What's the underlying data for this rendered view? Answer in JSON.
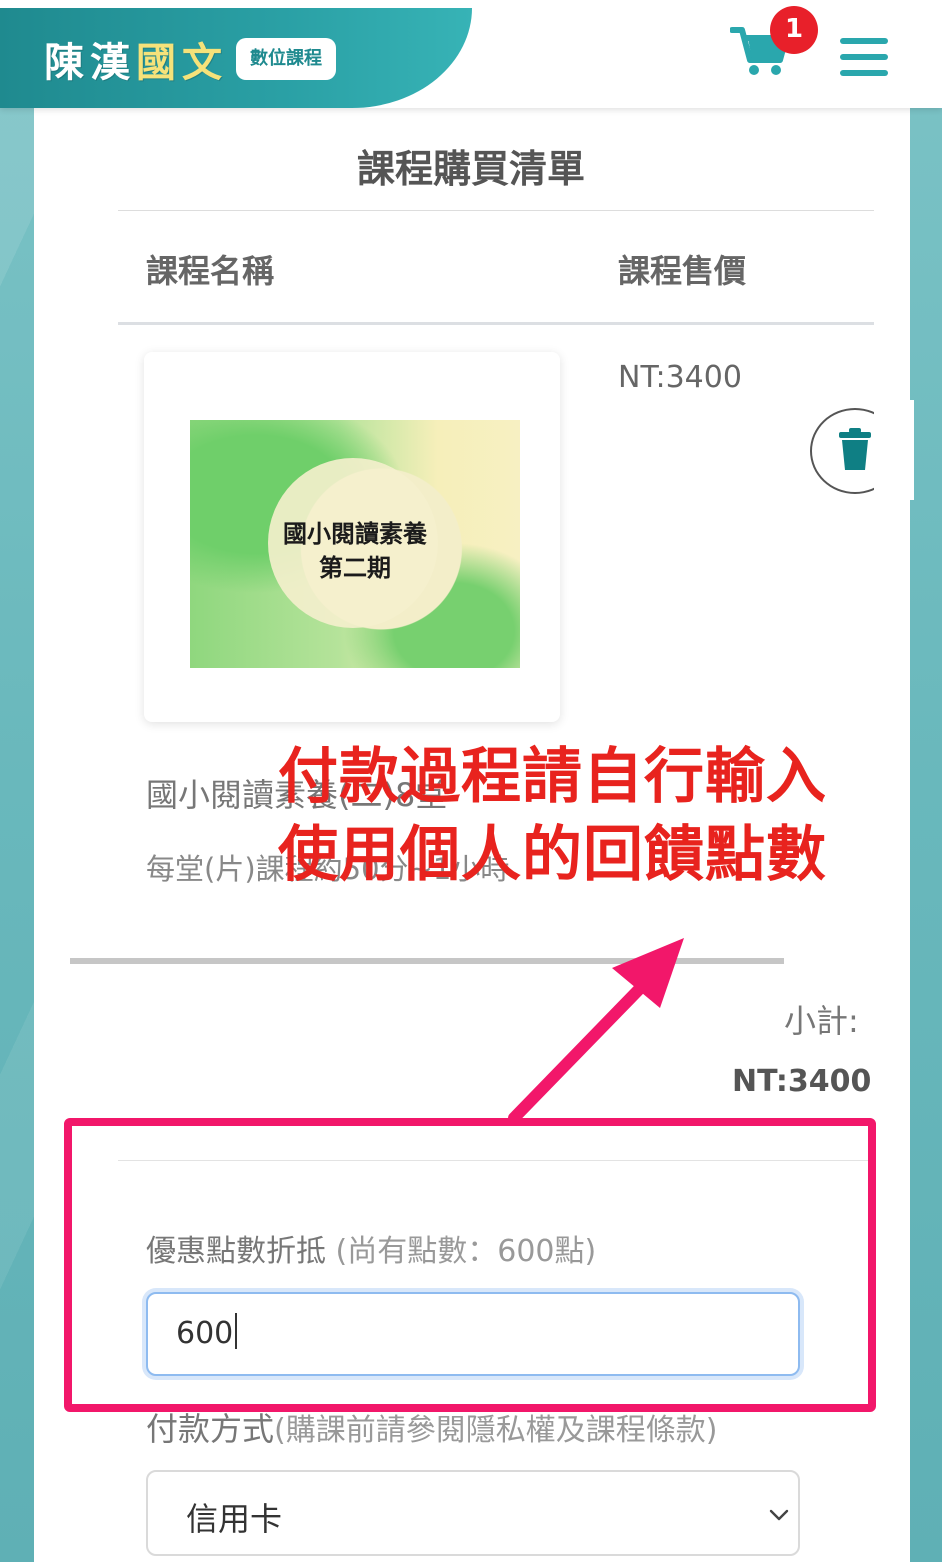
{
  "header": {
    "logo": {
      "part1": "陳漢",
      "part2": "國文"
    },
    "badge": "數位課程",
    "cart_count": "1"
  },
  "page": {
    "title": "課程購買清單",
    "col_name": "課程名稱",
    "col_price": "課程售價"
  },
  "course": {
    "thumb_line1": "國小閱讀素養",
    "thumb_line2": "第二期",
    "price": "NT:3400",
    "name": "國小閱讀素養(二)8堂",
    "desc": "每堂(片)課程約50分~1小時"
  },
  "summary": {
    "subtotal_label": "小計:",
    "subtotal_value": "NT:3400"
  },
  "points": {
    "label": "優惠點數折抵",
    "hint": " (尚有點數：600點)",
    "value": "600"
  },
  "payment": {
    "label": "付款方式",
    "hint": "(購課前請參閱隱私權及課程條款)",
    "selected": "信用卡"
  },
  "annotation": {
    "line1": "付款過程請自行輸入",
    "line2": "使用個人的回饋點數",
    "color": "#e8231e",
    "border_color": "#f2176a"
  }
}
